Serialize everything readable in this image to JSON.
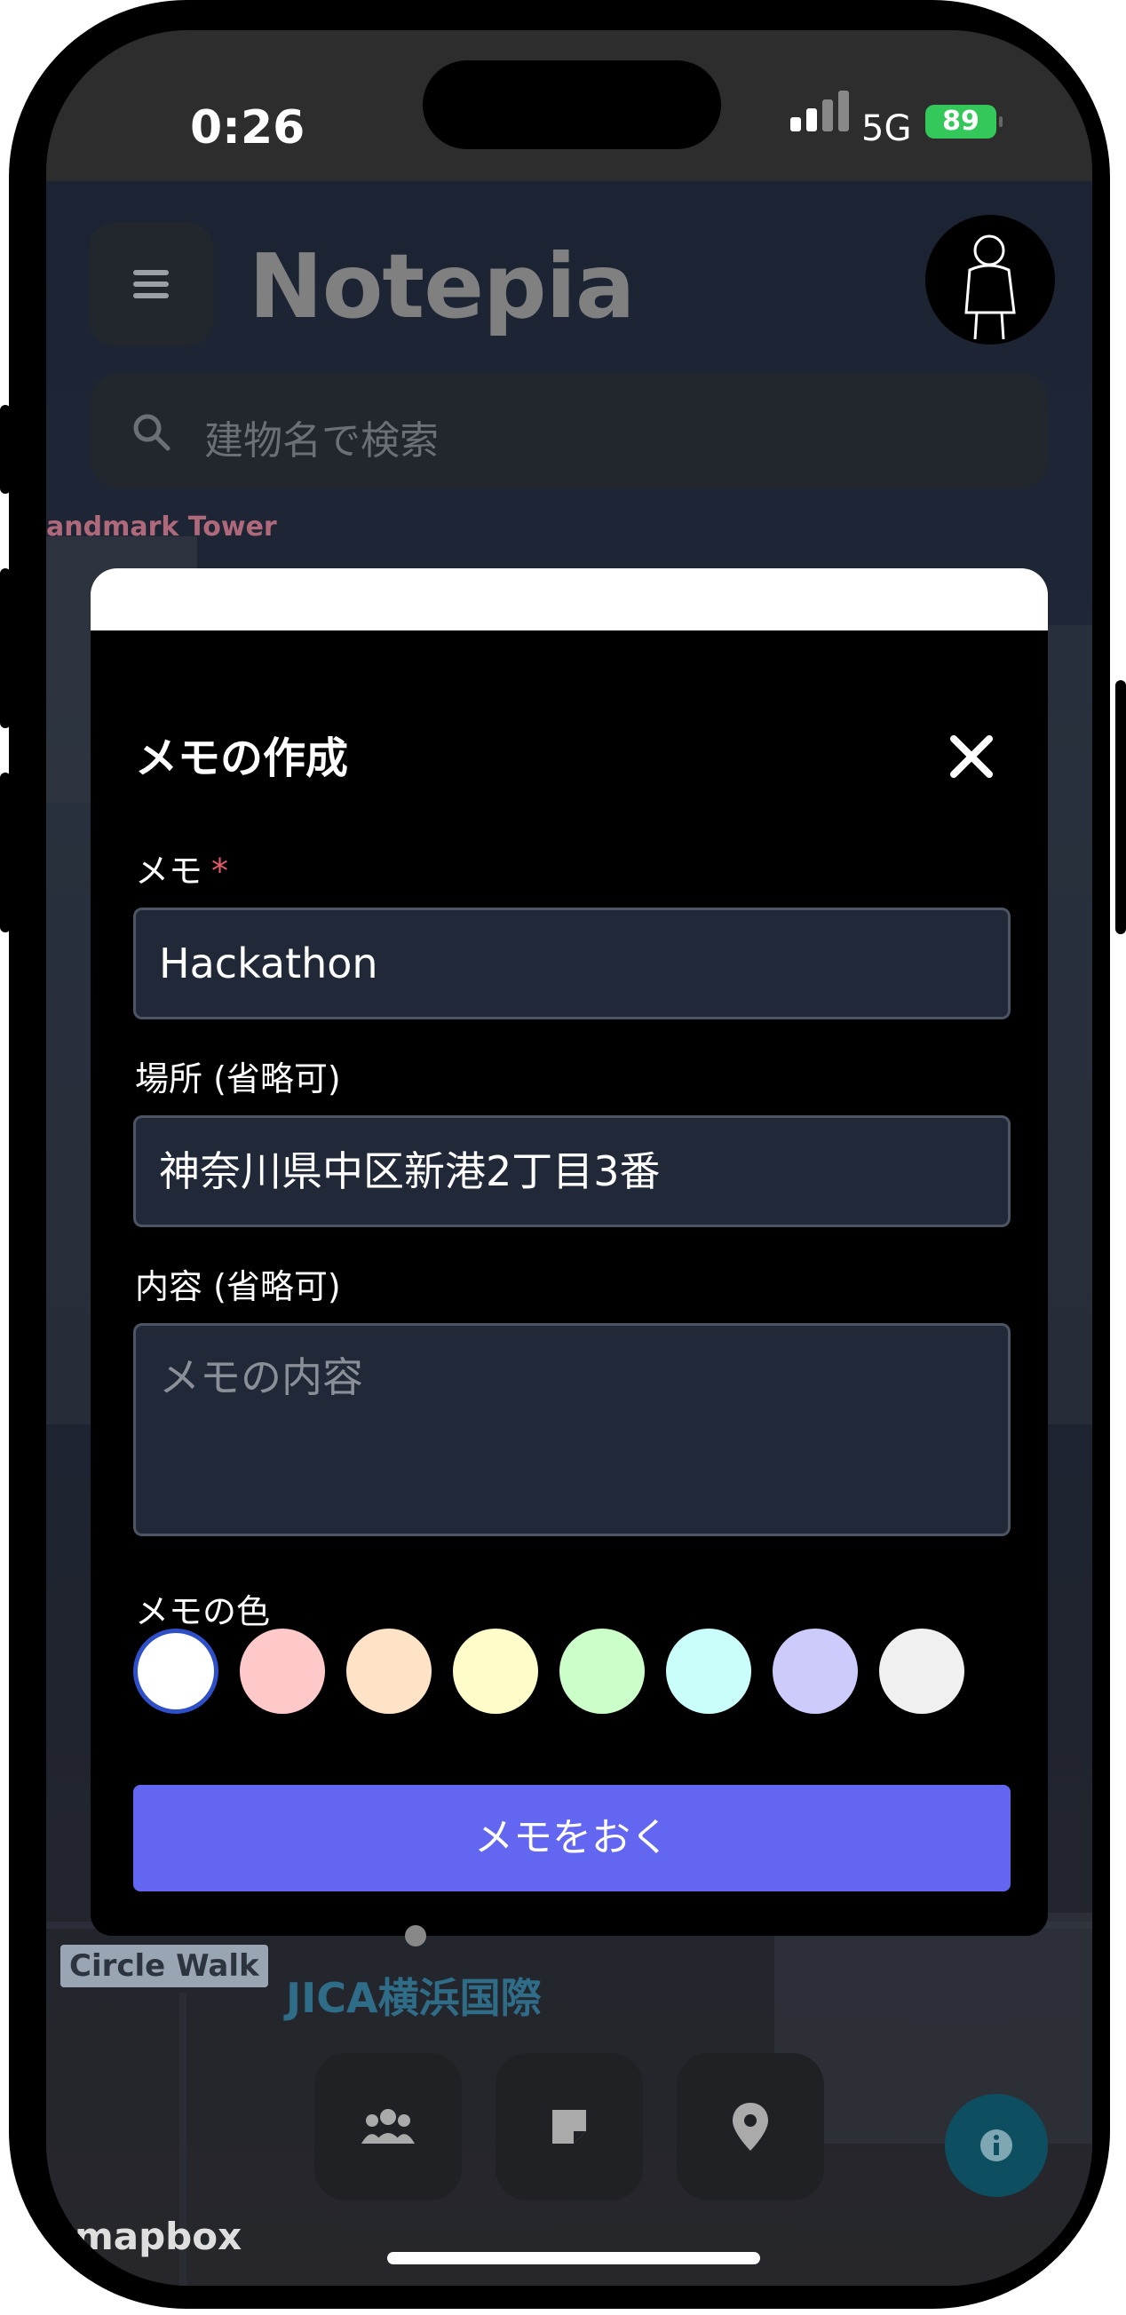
{
  "status_bar": {
    "time": "0:26",
    "network": "5G",
    "battery": "89"
  },
  "app": {
    "title": "Notepia",
    "search_placeholder": "建物名で検索"
  },
  "map": {
    "labels": [
      "andmark Tower",
      "Circle Walk",
      "JICA横浜国際"
    ],
    "attribution": "mapbox"
  },
  "modal": {
    "title": "メモの作成",
    "memo_label": "メモ",
    "required_mark": "*",
    "memo_value": "Hackathon",
    "location_label": "場所 (省略可)",
    "location_value": "神奈川県中区新港2丁目3番",
    "content_label": "内容 (省略可)",
    "content_placeholder": "メモの内容",
    "color_label": "メモの色",
    "colors": [
      "#ffffff",
      "#ffc9c9",
      "#ffe3c7",
      "#fefcc9",
      "#ccfec9",
      "#c9fefb",
      "#cccbfb",
      "#f0f0f0"
    ],
    "selected_color": "#ffffff",
    "submit_label": "メモをおく"
  },
  "bottom_nav": {
    "items": [
      {
        "icon": "users-icon"
      },
      {
        "icon": "note-icon"
      },
      {
        "icon": "location-pin-icon"
      }
    ],
    "info_icon": "info-icon"
  },
  "accent_color": "#6366f1"
}
